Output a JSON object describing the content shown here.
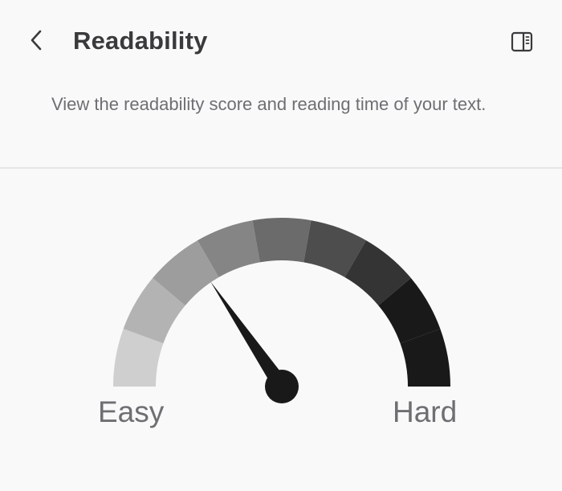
{
  "header": {
    "title": "Readability",
    "back_icon": "chevron-left-icon",
    "panel_icon": "sidebar-panel-icon"
  },
  "description": "View the readability score and reading time of your text.",
  "gauge": {
    "min_label": "Easy",
    "max_label": "Hard",
    "segment_count": 9,
    "needle_fraction": 0.31,
    "segment_colors": [
      "#cfcfcf",
      "#b3b3b3",
      "#9d9d9d",
      "#858585",
      "#6b6b6b",
      "#4d4d4d",
      "#343434",
      "#191919"
    ],
    "needle_color": "#19191a"
  }
}
